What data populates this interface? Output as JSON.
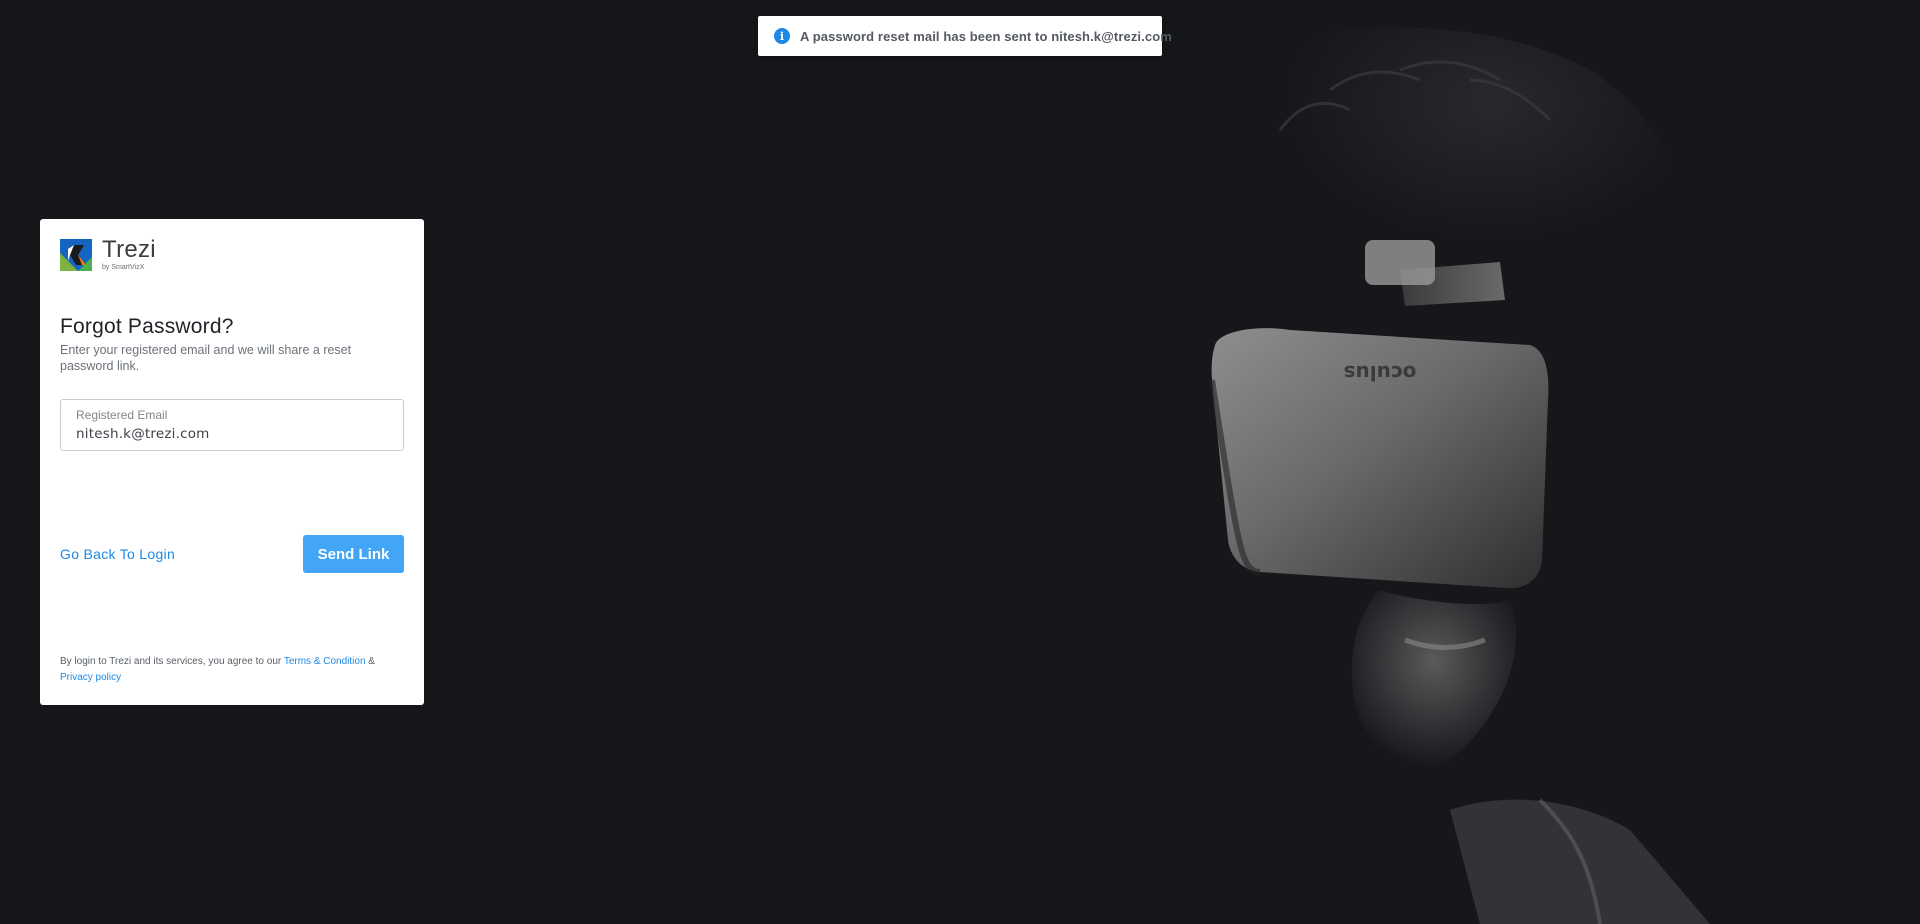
{
  "toast": {
    "icon": "info-icon",
    "icon_glyph": "i",
    "message": "A password reset mail has been sent to nitesh.k@trezi.com"
  },
  "brand": {
    "name": "Trezi",
    "tagline": "by SmartVizX",
    "logo_icon": "trezi-logo-icon"
  },
  "form": {
    "title": "Forgot Password?",
    "subtitle": "Enter your registered email and we will share a reset password link.",
    "email_label": "Registered Email",
    "email_value": "nitesh.k@trezi.com",
    "back_link": "Go Back To Login",
    "submit_label": "Send Link"
  },
  "legal": {
    "prefix": "By login to Trezi and its services, you agree to our ",
    "terms_link": "Terms & Condition",
    "separator": " & ",
    "privacy_link": "Privacy policy"
  },
  "background": {
    "headset_brand": "oculus"
  },
  "colors": {
    "page_background": "#15171b",
    "accent": "#1e88e5",
    "button": "#42a5f5"
  }
}
